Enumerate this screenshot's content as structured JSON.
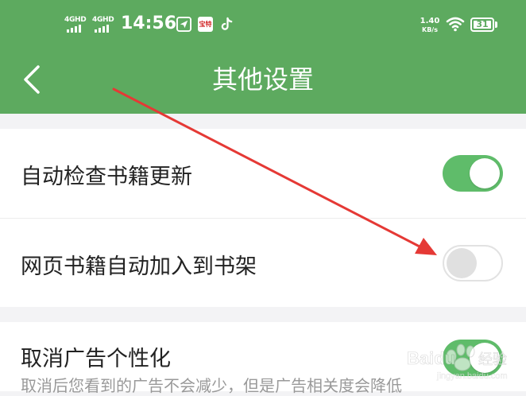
{
  "status_bar": {
    "signal_1": "4GHD",
    "signal_2": "4GHD",
    "time": "14:56",
    "app_badge": "宝特",
    "net_speed_value": "1.40",
    "net_speed_unit": "KB/s",
    "battery": "31"
  },
  "header": {
    "title": "其他设置",
    "back_icon": "chevron-left-icon",
    "color": "#5daa5f"
  },
  "settings": [
    {
      "label": "自动检查书籍更新",
      "enabled": true
    },
    {
      "label": "网页书籍自动加入到书架",
      "enabled": false
    }
  ],
  "settings_2": [
    {
      "label": "取消广告个性化",
      "subtitle": "取消后您看到的广告不会减少，但是广告相关度会降低",
      "enabled": true
    }
  ],
  "watermark": {
    "brand": "Baidu",
    "brand_cn": "经验",
    "url": "jingyan.baidu.com"
  },
  "annotation": {
    "arrow_color": "#e53935"
  }
}
